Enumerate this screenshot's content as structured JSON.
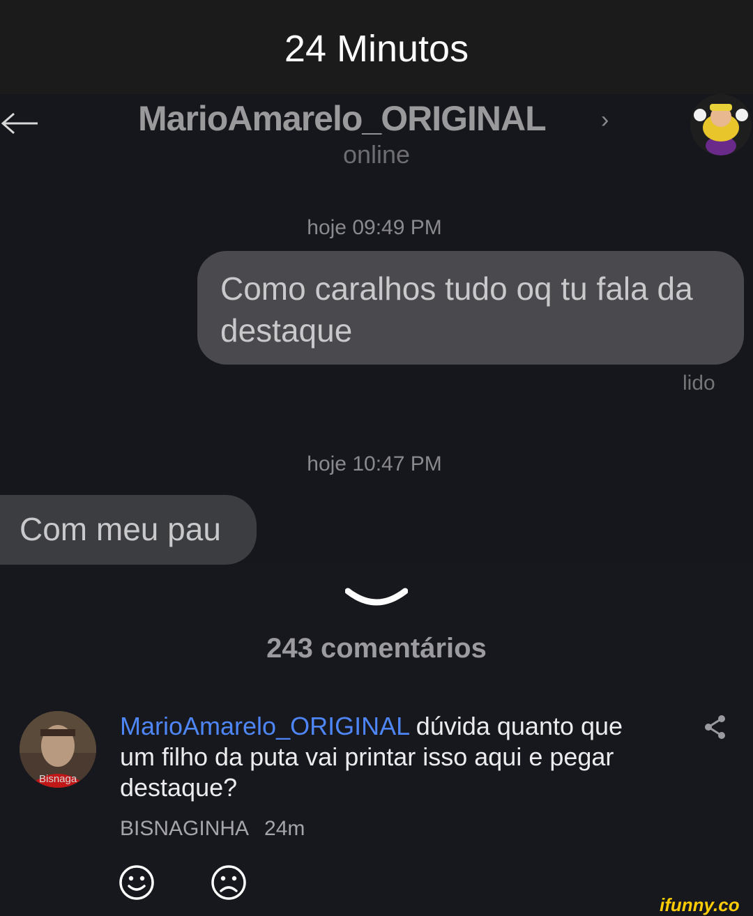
{
  "top_title": "24 Minutos",
  "chat": {
    "contact_name": "MarioAmarelo_ORIGINAL",
    "chevron": "›",
    "status": "online",
    "messages": [
      {
        "timestamp": "hoje 09:49 PM",
        "text": "Como caralhos tudo oq tu fala da destaque",
        "direction": "outgoing",
        "read_label": "lido"
      },
      {
        "timestamp": "hoje 10:47 PM",
        "text": "Com meu pau",
        "direction": "incoming"
      }
    ]
  },
  "comments_header": "243 comentários",
  "comment": {
    "mention": "MarioAmarelo_ORIGINAL",
    "text": " dúvida quanto que um filho da puta vai printar isso aqui e pegar destaque?",
    "author": "BISNAGINHA",
    "time": "24m",
    "avatar_caption": "Bisnaga"
  },
  "watermark": "ifunny.co",
  "icons": {
    "back": "arrow-left-icon",
    "collapse": "chevron-down-icon",
    "share": "share-icon",
    "smile": "smile-icon",
    "frown": "frown-icon"
  },
  "colors": {
    "mention": "#4f86f7",
    "brand": "#ffcc00"
  }
}
